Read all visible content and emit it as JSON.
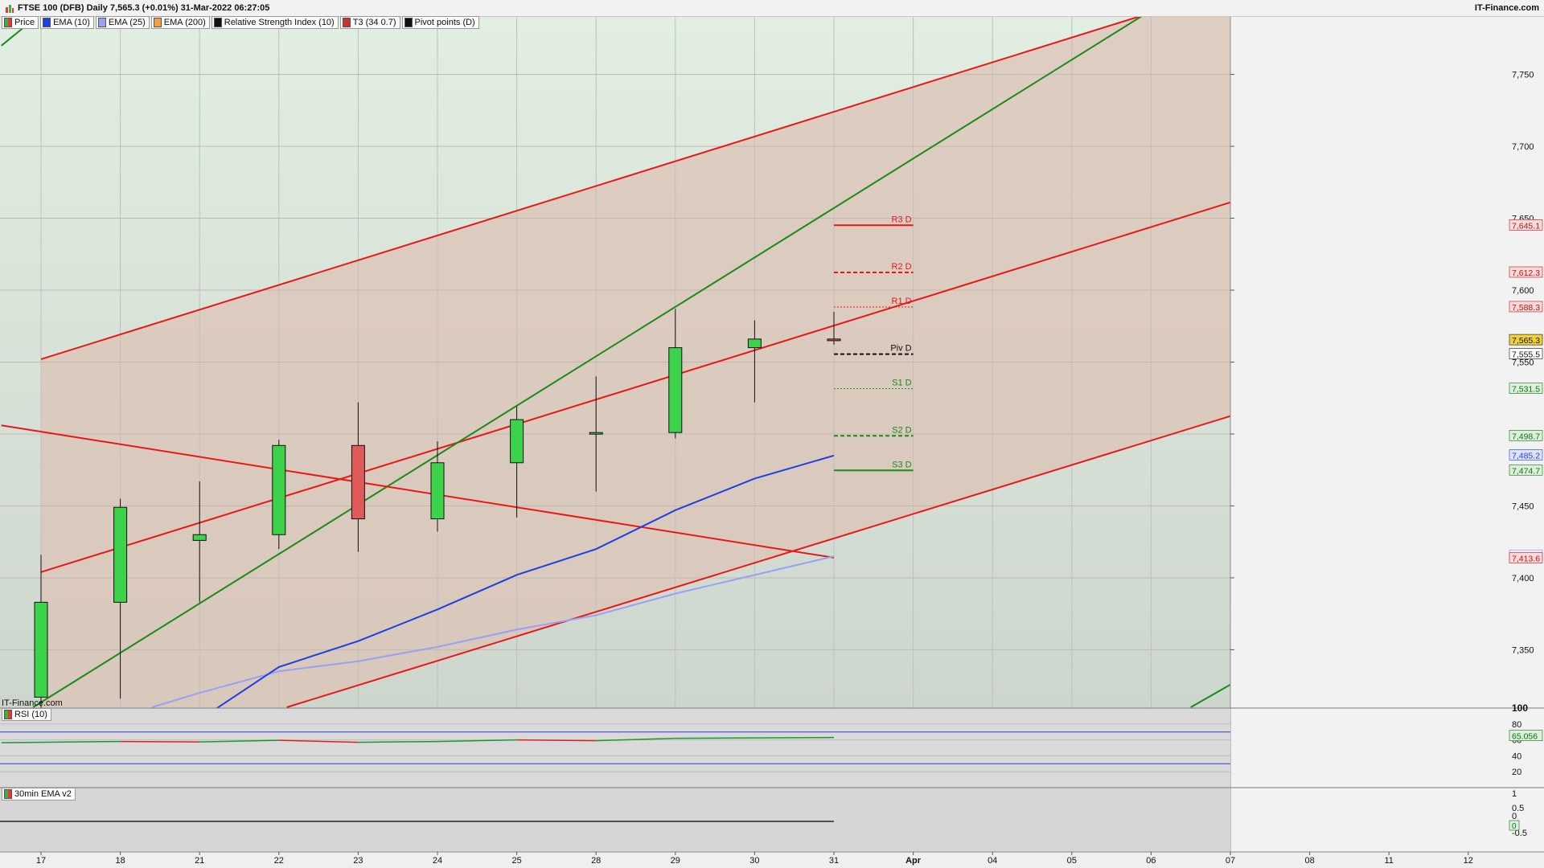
{
  "header": {
    "title": "FTSE 100 (DFB) Daily 7,565.3 (+0.01%) 31-Mar-2022 06:27:05",
    "brand": "IT-Finance.com"
  },
  "legend": [
    {
      "label": "Price",
      "color": "#3cb043"
    },
    {
      "label": "EMA (10)",
      "color": "#1f3fe0"
    },
    {
      "label": "EMA (25)",
      "color": "#9aa0f5"
    },
    {
      "label": "EMA (200)",
      "color": "#f5a040"
    },
    {
      "label": "Relative Strength Index (10)",
      "color": "#111111"
    },
    {
      "label": "T3 (34 0.7)",
      "color": "#d03030"
    },
    {
      "label": "Pivot points (D)",
      "color": "#111111"
    }
  ],
  "watermark": "IT-Finance.com",
  "rsi_label": "RSI (10)",
  "ema30_label": "30min EMA v2",
  "colors": {
    "bull": "#3cd24a",
    "bear": "#e05a5a",
    "channel_red": "#e81818",
    "trend_green": "#1a8a1a",
    "ema10": "#1f3fe0",
    "ema25": "#9aa0f5",
    "pivot": "#111111"
  },
  "chart_data": {
    "type": "candlestick",
    "x_labels": [
      "17",
      "18",
      "21",
      "22",
      "23",
      "24",
      "25",
      "28",
      "29",
      "30",
      "31",
      "Apr",
      "04",
      "05",
      "06",
      "07",
      "08",
      "11",
      "12"
    ],
    "ylim": [
      7310,
      7790
    ],
    "y_ticks": [
      7350,
      7400,
      7450,
      7500,
      7550,
      7600,
      7650,
      7700,
      7750
    ],
    "y_tick_labels": [
      "7,350",
      "7,400",
      "7,450",
      "7,500",
      "7,550",
      "7,600",
      "7,650",
      "7,700",
      "7,750"
    ],
    "candles": [
      {
        "date": "17",
        "open": 7317,
        "high": 7416,
        "low": 7303,
        "close": 7383
      },
      {
        "date": "18",
        "open": 7383,
        "high": 7455,
        "low": 7316,
        "close": 7449
      },
      {
        "date": "21",
        "open": 7426,
        "high": 7467,
        "low": 7383,
        "close": 7430
      },
      {
        "date": "22",
        "open": 7430,
        "high": 7496,
        "low": 7420,
        "close": 7492
      },
      {
        "date": "23",
        "open": 7492,
        "high": 7522,
        "low": 7418,
        "close": 7441
      },
      {
        "date": "24",
        "open": 7441,
        "high": 7495,
        "low": 7432,
        "close": 7480
      },
      {
        "date": "25",
        "open": 7480,
        "high": 7519,
        "low": 7442,
        "close": 7510
      },
      {
        "date": "28",
        "open": 7500,
        "high": 7540,
        "low": 7460,
        "close": 7501
      },
      {
        "date": "29",
        "open": 7501,
        "high": 7587,
        "low": 7497,
        "close": 7560
      },
      {
        "date": "30",
        "open": 7560,
        "high": 7579,
        "low": 7522,
        "close": 7566
      },
      {
        "date": "31",
        "open": 7566,
        "high": 7585,
        "low": 7562,
        "close": 7565
      }
    ],
    "ema10": [
      {
        "i": 2.1,
        "v": 7305
      },
      {
        "i": 3,
        "v": 7338
      },
      {
        "i": 4,
        "v": 7356
      },
      {
        "i": 5,
        "v": 7378
      },
      {
        "i": 6,
        "v": 7402
      },
      {
        "i": 7,
        "v": 7420
      },
      {
        "i": 8,
        "v": 7447
      },
      {
        "i": 9,
        "v": 7469
      },
      {
        "i": 10,
        "v": 7485
      }
    ],
    "ema25": [
      {
        "i": 1.4,
        "v": 7310
      },
      {
        "i": 2,
        "v": 7320
      },
      {
        "i": 3,
        "v": 7335
      },
      {
        "i": 4,
        "v": 7342
      },
      {
        "i": 5,
        "v": 7352
      },
      {
        "i": 6,
        "v": 7364
      },
      {
        "i": 7,
        "v": 7374
      },
      {
        "i": 8,
        "v": 7389
      },
      {
        "i": 9,
        "v": 7402
      },
      {
        "i": 10,
        "v": 7415
      }
    ],
    "t3_line": [
      {
        "i": -0.5,
        "v": 7506
      },
      {
        "i": 10,
        "v": 7414
      }
    ],
    "channel_lines": [
      [
        {
          "i": 0,
          "v": 7552
        },
        {
          "i": 14.3,
          "v": 7798
        }
      ],
      [
        {
          "i": 0,
          "v": 7404
        },
        {
          "i": 18.5,
          "v": 7721
        }
      ],
      [
        {
          "i": 3.1,
          "v": 7310
        },
        {
          "i": 18.5,
          "v": 7572
        }
      ]
    ],
    "trend_lines": [
      [
        {
          "i": -0.5,
          "v": 7770
        },
        {
          "i": 0.1,
          "v": 7797
        }
      ],
      [
        {
          "i": -0.1,
          "v": 7310
        },
        {
          "i": 14.1,
          "v": 7798
        }
      ],
      [
        {
          "i": 14.5,
          "v": 7310
        },
        {
          "i": 18.5,
          "v": 7436
        }
      ]
    ],
    "pivots": [
      {
        "label": "R3 D",
        "value": 7645.1,
        "style": "solid",
        "color": "#e81818"
      },
      {
        "label": "R2 D",
        "value": 7612.3,
        "style": "dashed",
        "color": "#e81818"
      },
      {
        "label": "R1 D",
        "value": 7588.3,
        "style": "dotted",
        "color": "#e81818"
      },
      {
        "label": "Piv D",
        "value": 7555.5,
        "style": "dashed",
        "color": "#111111"
      },
      {
        "label": "S1 D",
        "value": 7531.5,
        "style": "dotted",
        "color": "#1a8a1a"
      },
      {
        "label": "S2 D",
        "value": 7498.7,
        "style": "dashed",
        "color": "#1a8a1a"
      },
      {
        "label": "S3 D",
        "value": 7474.7,
        "style": "solid",
        "color": "#1a8a1a"
      }
    ],
    "price_tags": [
      {
        "value": 7645.1,
        "label": "7,645.1",
        "bg": "#f8dcdc",
        "fg": "#c01010"
      },
      {
        "value": 7612.3,
        "label": "7,612.3",
        "bg": "#f8dcdc",
        "fg": "#c01010"
      },
      {
        "value": 7588.3,
        "label": "7,588.3",
        "bg": "#f8dcdc",
        "fg": "#c01010"
      },
      {
        "value": 7565.3,
        "label": "7,565.3",
        "bg": "#f2d23a",
        "fg": "#111111"
      },
      {
        "value": 7555.5,
        "label": "7,555.5",
        "bg": "#ffffff",
        "fg": "#111111"
      },
      {
        "value": 7531.5,
        "label": "7,531.5",
        "bg": "#dcf0dc",
        "fg": "#107010"
      },
      {
        "value": 7498.7,
        "label": "7,498.7",
        "bg": "#dcf0dc",
        "fg": "#107010"
      },
      {
        "value": 7485.2,
        "label": "7,485.2",
        "bg": "#dde3ff",
        "fg": "#1f3fe0"
      },
      {
        "value": 7474.7,
        "label": "7,474.7",
        "bg": "#dcf0dc",
        "fg": "#107010"
      },
      {
        "value": 7415.5,
        "label": "7,415.5",
        "bg": "#eceeff",
        "fg": "#8a90e0"
      },
      {
        "value": 7413.6,
        "label": "7,413.6",
        "bg": "#f8dcdc",
        "fg": "#c01010"
      }
    ],
    "rsi": {
      "values": [
        {
          "i": -0.5,
          "v": 56.5
        },
        {
          "i": 1,
          "v": 58
        },
        {
          "i": 2,
          "v": 57.5
        },
        {
          "i": 3,
          "v": 59.5
        },
        {
          "i": 4,
          "v": 57
        },
        {
          "i": 5,
          "v": 58
        },
        {
          "i": 6,
          "v": 60
        },
        {
          "i": 7,
          "v": 59
        },
        {
          "i": 8,
          "v": 62
        },
        {
          "i": 9,
          "v": 62.5
        },
        {
          "i": 10,
          "v": 63
        }
      ],
      "levels": [
        70,
        30
      ],
      "y_ticks": [
        100,
        80,
        60,
        40,
        20
      ],
      "current": "65.056"
    },
    "ema30": {
      "y_ticks": [
        "1",
        "0.5",
        "0",
        "-0.5"
      ],
      "current": "0"
    }
  }
}
